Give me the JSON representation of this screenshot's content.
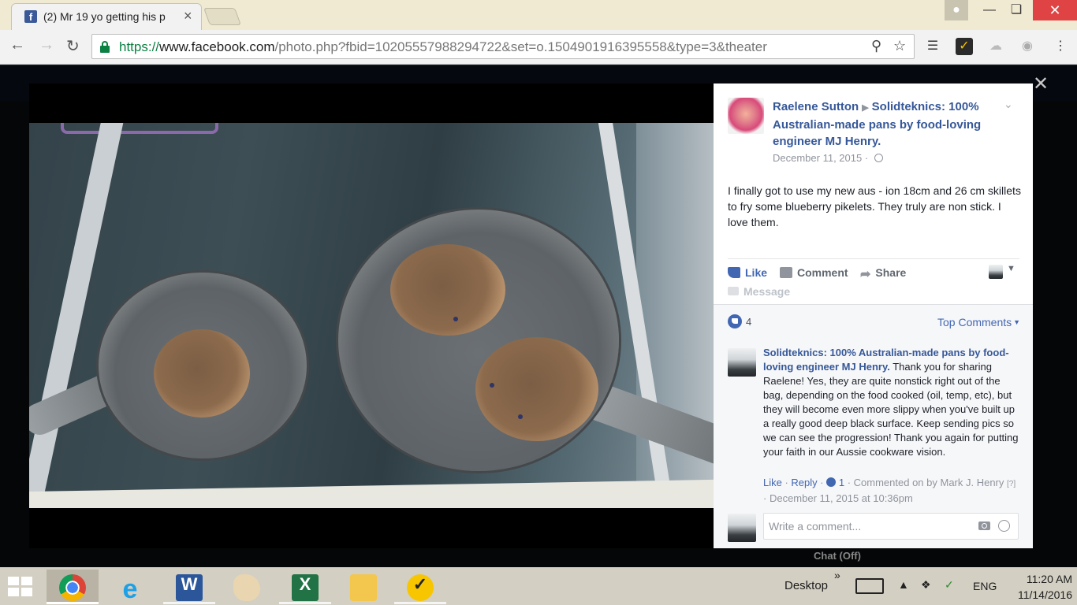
{
  "browser": {
    "tab_title": "(2) Mr 19 yo getting his p",
    "url_scheme": "https://",
    "url_host": "www.facebook.com",
    "url_path": "/photo.php?fbid=10205557988294722&set=o.1504901916395558&type=3&theater"
  },
  "post": {
    "author": "Raelene Sutton",
    "target_page": "Solidteknics: 100% Australian-made pans by food-loving engineer MJ Henry.",
    "date": "December 11, 2015 · ",
    "text": "I finally got to use my new aus - ion 18cm and 26 cm skillets to fry some blueberry pikelets. They truly are non stick. I love them.",
    "actions": {
      "like": "Like",
      "comment": "Comment",
      "share": "Share",
      "message": "Message"
    },
    "like_count": "4",
    "top_comments": "Top Comments"
  },
  "comment": {
    "author": "Solidteknics: 100% Australian-made pans by food-loving engineer MJ Henry.",
    "text": " Thank you for sharing Raelene! Yes, they are quite nonstick right out of the bag, depending on the food cooked (oil, temp, etc), but they will become even more slippy when you've built up a really good deep black surface. Keep sending pics so we can see the progression! Thank you again for putting your faith in our Aussie cookware vision.",
    "like": "Like",
    "reply": "Reply",
    "like_count": "1",
    "commented_by": "Commented on by Mark J. Henry",
    "marker": "[?]",
    "timestamp": "December 11, 2015 at 10:36pm"
  },
  "write_comment": {
    "placeholder": "Write a comment..."
  },
  "background_page": {
    "chat": "Chat (Off)"
  },
  "taskbar": {
    "desktop_label": "Desktop",
    "language": "ENG",
    "time": "11:20 AM",
    "date": "11/14/2016"
  },
  "colors": {
    "facebook_blue": "#4267b2",
    "link_blue": "#365899",
    "close_red": "#e04343"
  }
}
